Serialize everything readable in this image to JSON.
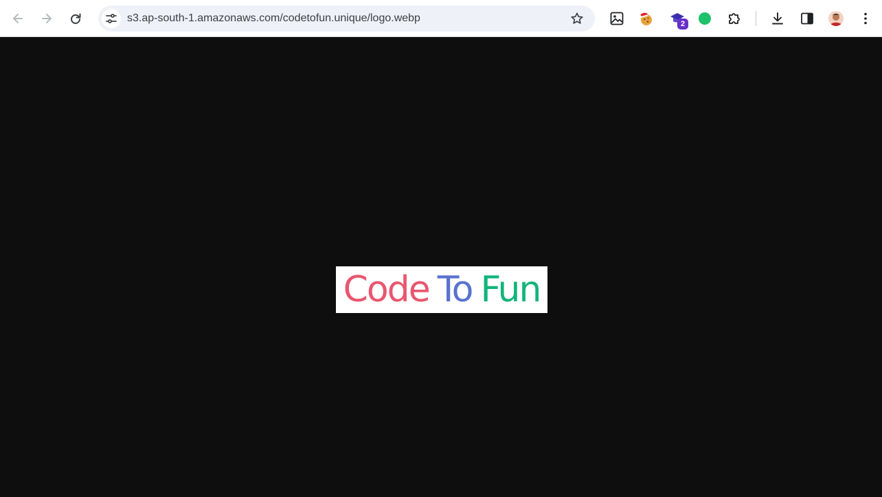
{
  "browser": {
    "url": "s3.ap-south-1.amazonaws.com/codetofun.unique/logo.webp",
    "icons": {
      "back": "arrow-left-icon",
      "forward": "arrow-right-icon",
      "reload": "reload-icon",
      "site_info": "tune-icon",
      "bookmark": "star-icon",
      "image_ext": "image-icon",
      "cookie_ext": "cookie-santa-icon",
      "tutor_ext": "graduation-cap-icon",
      "status_ext": "green-dot-icon",
      "extensions": "puzzle-icon",
      "downloads": "download-icon",
      "side_panel": "side-panel-icon",
      "profile": "avatar-icon",
      "menu": "kebab-menu-icon"
    },
    "tutor_ext_badge": "2"
  },
  "image": {
    "logo_parts": [
      {
        "text": "Code",
        "color": "#e9566f"
      },
      {
        "text": "To",
        "color": "#5a72cf"
      },
      {
        "text": "Fun",
        "color": "#13b47a"
      }
    ]
  },
  "colors": {
    "page_background": "#0e0e0e",
    "status_dot": "#1ec26a"
  }
}
